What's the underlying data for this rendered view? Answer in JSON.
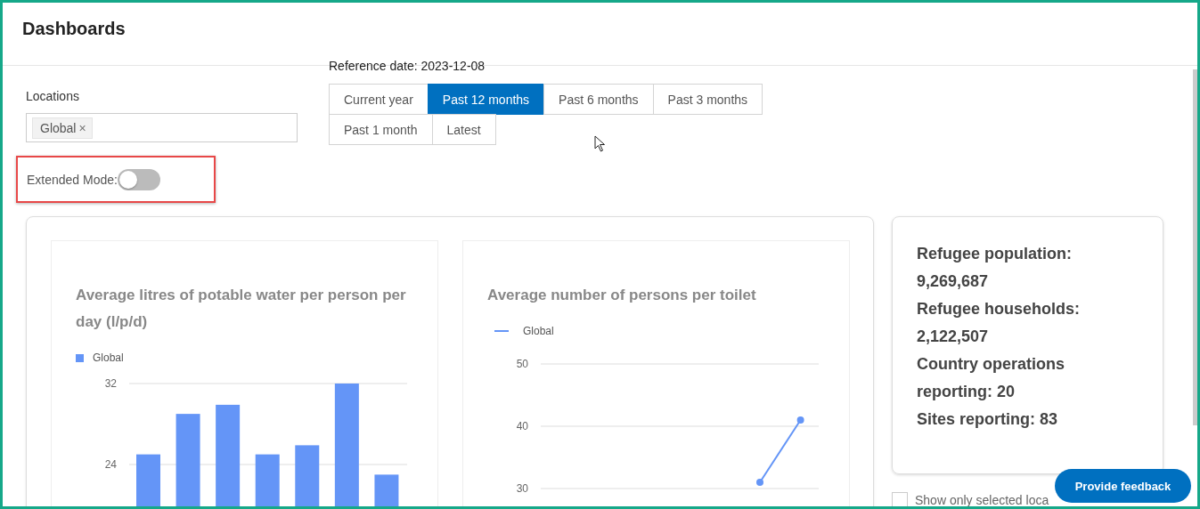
{
  "header": {
    "title": "Dashboards"
  },
  "filters": {
    "reference_date": "Reference date: 2023-12-08",
    "locations_label": "Locations",
    "locations": [
      {
        "label": "Global",
        "remove": "×"
      }
    ],
    "periods": [
      {
        "label": "Current year",
        "selected": false
      },
      {
        "label": "Past 12 months",
        "selected": true
      },
      {
        "label": "Past 6 months",
        "selected": false
      },
      {
        "label": "Past 3 months",
        "selected": false
      },
      {
        "label": "Past 1 month",
        "selected": false
      },
      {
        "label": "Latest",
        "selected": false
      }
    ],
    "extended_mode": {
      "label": "Extended Mode:",
      "on": false
    }
  },
  "charts": [
    {
      "title": "Average litres of potable water per person per day (l/p/d)",
      "chart_data": {
        "type": "bar",
        "ylim": [
          0,
          32
        ],
        "yticks": [
          24,
          32
        ],
        "series": [
          {
            "name": "Global",
            "color": "#6495f7",
            "values": [
              25,
              29,
              29.9,
              25,
              25.9,
              32,
              23
            ]
          }
        ]
      }
    },
    {
      "title": "Average number of persons per toilet",
      "chart_data": {
        "type": "line",
        "ylim": [
          30,
          50
        ],
        "yticks": [
          30,
          40,
          50
        ],
        "series": [
          {
            "name": "Global",
            "color": "#6495f7",
            "marker": "circle",
            "values": [
              null,
              null,
              null,
              null,
              null,
              31,
              41
            ]
          }
        ]
      }
    }
  ],
  "stats": [
    "Refugee population: 9,269,687",
    "Refugee households: 2,122,507",
    "Country operations reporting: 20",
    "Sites reporting: 83"
  ],
  "show_only_selected": {
    "label": "Show only selected loca",
    "checked": false
  },
  "feedback_button": "Provide feedback"
}
